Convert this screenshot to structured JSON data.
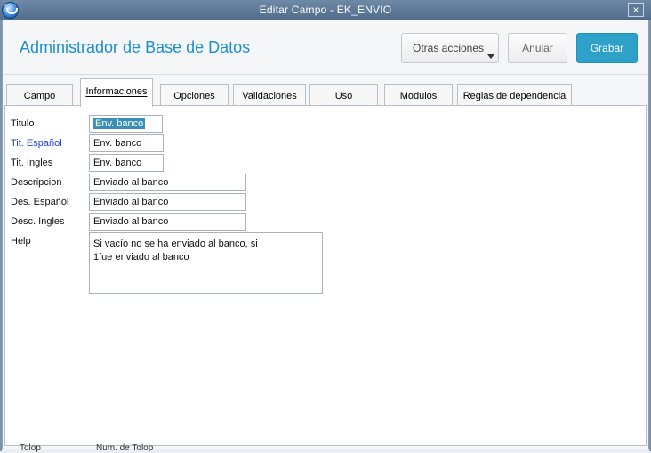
{
  "window": {
    "title": "Editar Campo - EK_ENVIO",
    "close_glyph": "×"
  },
  "header": {
    "app_title": "Administrador de Base de Datos",
    "more_actions_label": "Otras acciones",
    "cancel_label": "Anular",
    "save_label": "Grabar"
  },
  "tabs": [
    {
      "label": "Campo"
    },
    {
      "label": "Informaciones",
      "active": true
    },
    {
      "label": "Opciones"
    },
    {
      "label": "Validaciones"
    },
    {
      "label": "Uso"
    },
    {
      "label": "Modulos"
    },
    {
      "label": "Reglas de dependencia"
    }
  ],
  "form": {
    "titulo": {
      "label": "Titulo",
      "value": "Env. banco"
    },
    "tit_espanol": {
      "label": "Tit. Español",
      "value": "Env. banco"
    },
    "tit_ingles": {
      "label": "Tit. Ingles",
      "value": "Env. banco"
    },
    "descripcion": {
      "label": "Descripcion",
      "value": "Enviado al banco"
    },
    "des_espanol": {
      "label": "Des. Español",
      "value": "Enviado al banco"
    },
    "desc_ingles": {
      "label": "Desc. Ingles",
      "value": "Enviado al banco"
    },
    "help": {
      "label": "Help",
      "line1": "Si vacío no se ha enviado al banco, si",
      "line2": "1fue enviado al banco"
    }
  },
  "background_fragments": [
    "Tolop",
    "Num. de Tolop"
  ],
  "colors": {
    "accent": "#1d8fd1",
    "save_button": "#2ea1c9",
    "highlight_label": "#1c3fd6",
    "titlebar": "#5b7896"
  },
  "icons": {
    "app": "app-logo-icon",
    "close": "close-icon",
    "dropdown": "chevron-down-icon"
  }
}
